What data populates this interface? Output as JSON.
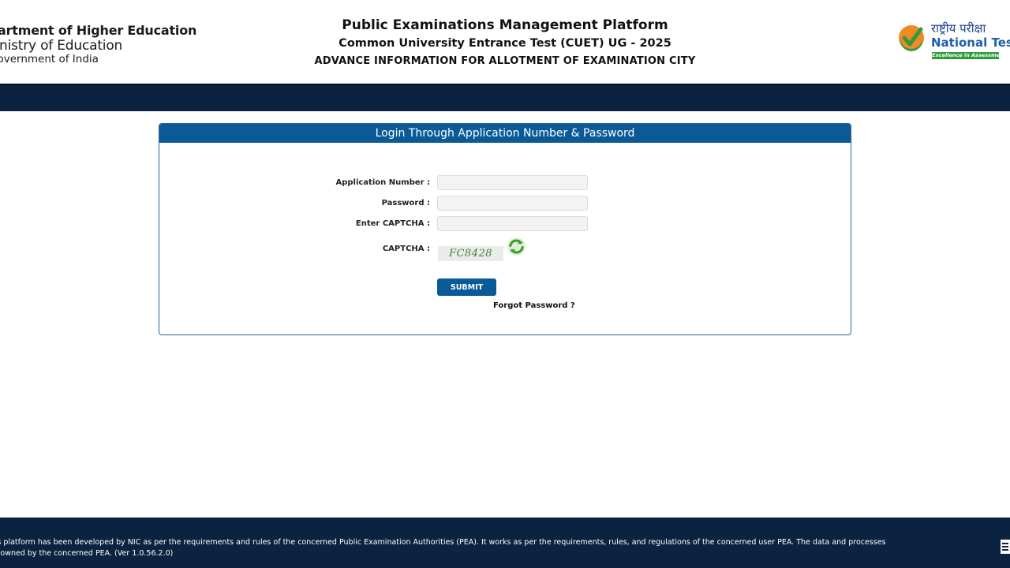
{
  "header": {
    "ministry": {
      "line1": "Department of Higher Education",
      "line2": "Ministry of Education",
      "line3": "Government of India"
    },
    "title": "Public Examinations Management Platform",
    "subtitle": "Common University Entrance Test (CUET) UG - 2025",
    "subtitle2": "ADVANCE INFORMATION FOR ALLOTMENT OF EXAMINATION CITY",
    "nta": {
      "hindi": "राष्ट्रीय परीक्षा",
      "english": "National Testing",
      "tagline": "Excellence in Assessment"
    }
  },
  "login": {
    "heading": "Login Through Application Number & Password",
    "application_number_label": "Application Number :",
    "password_label": "Password :",
    "enter_captcha_label": "Enter CAPTCHA :",
    "captcha_label": "CAPTCHA :",
    "captcha_text": "FC8428",
    "application_number_value": "",
    "password_value": "",
    "captcha_value": "",
    "submit_label": "SUBMIT",
    "forgot_label": "Forgot Password ?"
  },
  "footer": {
    "text": "This platform has been developed by NIC as per the requirements and rules of the concerned Public Examination Authorities (PEA). It works as per the requirements, rules, and regulations of the concerned user PEA. The data and processes are owned by the concerned PEA. (Ver 1.0.56.2.0)"
  },
  "colors": {
    "navy": "#0b2240",
    "panel_header": "#0b5a98",
    "nta_green": "#2e9c3a",
    "nta_orange": "#f08a24"
  },
  "icons": {
    "refresh": "refresh-icon",
    "nta_logo": "nta-check-logo"
  }
}
